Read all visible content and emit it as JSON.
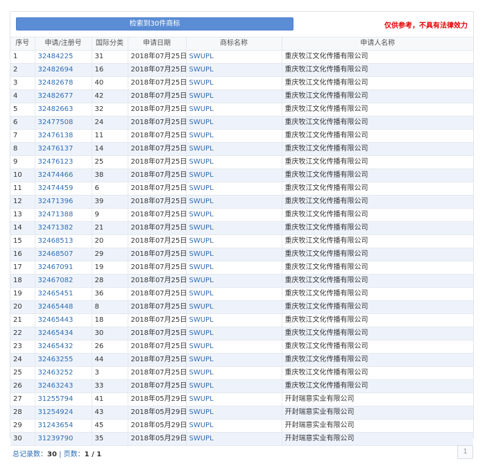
{
  "header": {
    "result_button": "检索到30件商标",
    "disclaimer": "仅供参考，不具有法律效力"
  },
  "table": {
    "columns": [
      "序号",
      "申请/注册号",
      "国际分类",
      "申请日期",
      "商标名称",
      "申请人名称"
    ],
    "rows": [
      [
        "1",
        "32484225",
        "31",
        "2018年07月25日",
        "SWUPL",
        "重庆牧江文化传播有限公司"
      ],
      [
        "2",
        "32482694",
        "16",
        "2018年07月25日",
        "SWUPL",
        "重庆牧江文化传播有限公司"
      ],
      [
        "3",
        "32482678",
        "40",
        "2018年07月25日",
        "SWUPL",
        "重庆牧江文化传播有限公司"
      ],
      [
        "4",
        "32482677",
        "42",
        "2018年07月25日",
        "SWUPL",
        "重庆牧江文化传播有限公司"
      ],
      [
        "5",
        "32482663",
        "32",
        "2018年07月25日",
        "SWUPL",
        "重庆牧江文化传播有限公司"
      ],
      [
        "6",
        "32477508",
        "24",
        "2018年07月25日",
        "SWUPL",
        "重庆牧江文化传播有限公司"
      ],
      [
        "7",
        "32476138",
        "11",
        "2018年07月25日",
        "SWUPL",
        "重庆牧江文化传播有限公司"
      ],
      [
        "8",
        "32476137",
        "14",
        "2018年07月25日",
        "SWUPL",
        "重庆牧江文化传播有限公司"
      ],
      [
        "9",
        "32476123",
        "25",
        "2018年07月25日",
        "SWUPL",
        "重庆牧江文化传播有限公司"
      ],
      [
        "10",
        "32474466",
        "38",
        "2018年07月25日",
        "SWUPL",
        "重庆牧江文化传播有限公司"
      ],
      [
        "11",
        "32474459",
        "6",
        "2018年07月25日",
        "SWUPL",
        "重庆牧江文化传播有限公司"
      ],
      [
        "12",
        "32471396",
        "39",
        "2018年07月25日",
        "SWUPL",
        "重庆牧江文化传播有限公司"
      ],
      [
        "13",
        "32471388",
        "9",
        "2018年07月25日",
        "SWUPL",
        "重庆牧江文化传播有限公司"
      ],
      [
        "14",
        "32471382",
        "21",
        "2018年07月25日",
        "SWUPL",
        "重庆牧江文化传播有限公司"
      ],
      [
        "15",
        "32468513",
        "20",
        "2018年07月25日",
        "SWUPL",
        "重庆牧江文化传播有限公司"
      ],
      [
        "16",
        "32468507",
        "29",
        "2018年07月25日",
        "SWUPL",
        "重庆牧江文化传播有限公司"
      ],
      [
        "17",
        "32467091",
        "19",
        "2018年07月25日",
        "SWUPL",
        "重庆牧江文化传播有限公司"
      ],
      [
        "18",
        "32467082",
        "28",
        "2018年07月25日",
        "SWUPL",
        "重庆牧江文化传播有限公司"
      ],
      [
        "19",
        "32465451",
        "36",
        "2018年07月25日",
        "SWUPL",
        "重庆牧江文化传播有限公司"
      ],
      [
        "20",
        "32465448",
        "8",
        "2018年07月25日",
        "SWUPL",
        "重庆牧江文化传播有限公司"
      ],
      [
        "21",
        "32465443",
        "18",
        "2018年07月25日",
        "SWUPL",
        "重庆牧江文化传播有限公司"
      ],
      [
        "22",
        "32465434",
        "30",
        "2018年07月25日",
        "SWUPL",
        "重庆牧江文化传播有限公司"
      ],
      [
        "23",
        "32465432",
        "26",
        "2018年07月25日",
        "SWUPL",
        "重庆牧江文化传播有限公司"
      ],
      [
        "24",
        "32463255",
        "44",
        "2018年07月25日",
        "SWUPL",
        "重庆牧江文化传播有限公司"
      ],
      [
        "25",
        "32463252",
        "3",
        "2018年07月25日",
        "SWUPL",
        "重庆牧江文化传播有限公司"
      ],
      [
        "26",
        "32463243",
        "33",
        "2018年07月25日",
        "SWUPL",
        "重庆牧江文化传播有限公司"
      ],
      [
        "27",
        "31255794",
        "41",
        "2018年05月29日",
        "SWUPL",
        "开封瑞意实业有限公司"
      ],
      [
        "28",
        "31254924",
        "43",
        "2018年05月29日",
        "SWUPL",
        "开封瑞意实业有限公司"
      ],
      [
        "29",
        "31243654",
        "45",
        "2018年05月29日",
        "SWUPL",
        "开封瑞意实业有限公司"
      ],
      [
        "30",
        "31239790",
        "35",
        "2018年05月29日",
        "SWUPL",
        "开封瑞意实业有限公司"
      ]
    ]
  },
  "footer": {
    "total_label": "总记录数：",
    "total_value": "30",
    "separator": " | ",
    "pages_label": "页数：",
    "pages_value": "1 / 1",
    "page_button": "1"
  },
  "colors": {
    "accent": "#5b8dd6",
    "link": "#2f6db5",
    "warning": "#e60000",
    "row_alt": "#eef3fb"
  }
}
